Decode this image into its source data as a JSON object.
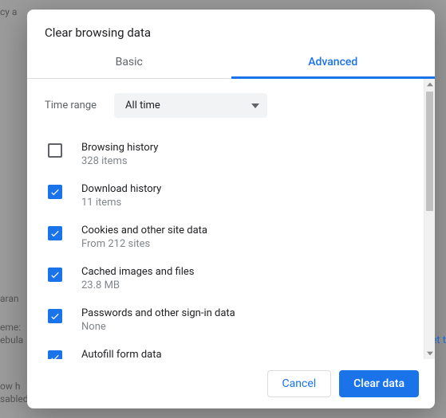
{
  "dialog": {
    "title": "Clear browsing data",
    "tabs": {
      "basic": "Basic",
      "advanced": "Advanced"
    },
    "time_range_label": "Time range",
    "time_range_value": "All time",
    "options": {
      "browsing": {
        "title": "Browsing history",
        "sub": "328 items",
        "checked": false
      },
      "download": {
        "title": "Download history",
        "sub": "11 items",
        "checked": true
      },
      "cookies": {
        "title": "Cookies and other site data",
        "sub": "From 212 sites",
        "checked": true
      },
      "cache": {
        "title": "Cached images and files",
        "sub": "23.8 MB",
        "checked": true
      },
      "passwords": {
        "title": "Passwords and other sign-in data",
        "sub": "None",
        "checked": true
      },
      "autofill": {
        "title": "Autofill form data",
        "sub": "",
        "checked": true
      }
    },
    "buttons": {
      "cancel": "Cancel",
      "clear": "Clear data"
    }
  },
  "background": {
    "line1": "cy a",
    "line2": "aran",
    "line3": "eme:",
    "line4": "ebula",
    "line5": "ow h",
    "line6": "sabled",
    "link1": "et t"
  }
}
